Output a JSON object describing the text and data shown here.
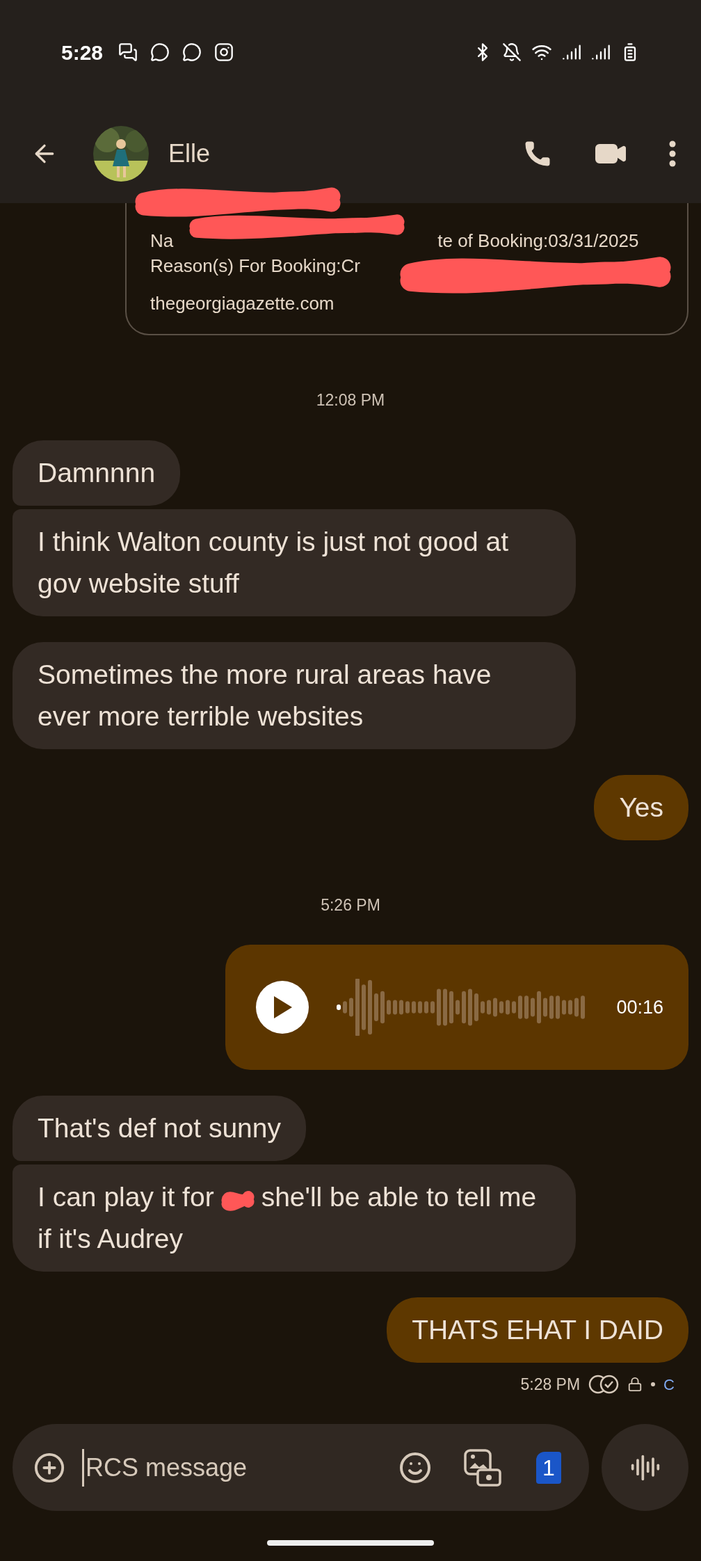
{
  "status_bar": {
    "time": "5:28"
  },
  "header": {
    "contact_name": "Elle"
  },
  "link_preview": {
    "lines": [
      [
        "Na",
        "te of Booking:03/31/2025"
      ],
      [
        "Reason(s) For Booking:Cr"
      ]
    ],
    "domain": "thegeorgiagazette.com"
  },
  "messages": [
    {
      "kind": "timestamp",
      "text": "12:08 PM"
    },
    {
      "kind": "incoming",
      "text": "Damnnnn",
      "joined_above": false
    },
    {
      "kind": "incoming",
      "text": "I think Walton county is just not good at gov website stuff",
      "joined_above": true
    },
    {
      "kind": "incoming",
      "text": "Sometimes the more rural areas have ever more terrible websites",
      "joined_above": false
    },
    {
      "kind": "outgoing",
      "text": "Yes",
      "joined_above": false
    },
    {
      "kind": "timestamp",
      "text": "5:26 PM"
    },
    {
      "kind": "voice",
      "duration": "00:16"
    },
    {
      "kind": "incoming",
      "text": "That's def not sunny",
      "joined_above": false
    },
    {
      "kind": "redacted",
      "parts": [
        "I can play it for",
        "she'll be able to tell me if it's Audrey"
      ],
      "joined_above": true
    },
    {
      "kind": "outgoing",
      "text": "THATS EHAT I DAID",
      "joined_above": false
    }
  ],
  "delivery": {
    "time": "5:28 PM",
    "network": "C"
  },
  "composer": {
    "placeholder": "RCS message",
    "sim": "1"
  }
}
